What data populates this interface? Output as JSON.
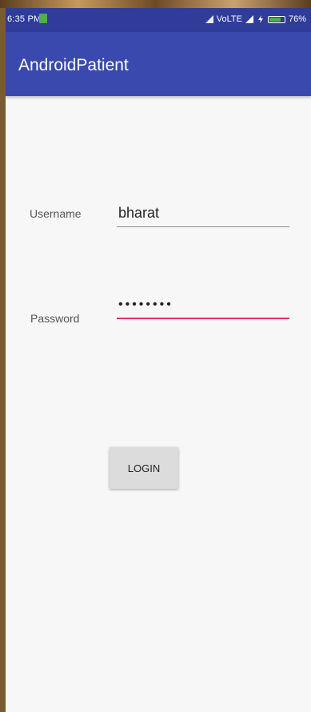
{
  "status_bar": {
    "time": "6:35 PM",
    "network": "VoLTE",
    "battery": "76%",
    "battery_level": 0.76,
    "notification_icon": "message-icon",
    "signal_icons": [
      "signal-icon",
      "signal-icon"
    ],
    "charging_icon": "charging-icon"
  },
  "app_bar": {
    "title": "AndroidPatient",
    "color": "#3a49ad"
  },
  "form": {
    "username_label": "Username",
    "username_value": "bharat",
    "password_label": "Password",
    "password_value": "••••••••",
    "password_underline_color": "#e2306c",
    "login_label": "LOGIN"
  }
}
